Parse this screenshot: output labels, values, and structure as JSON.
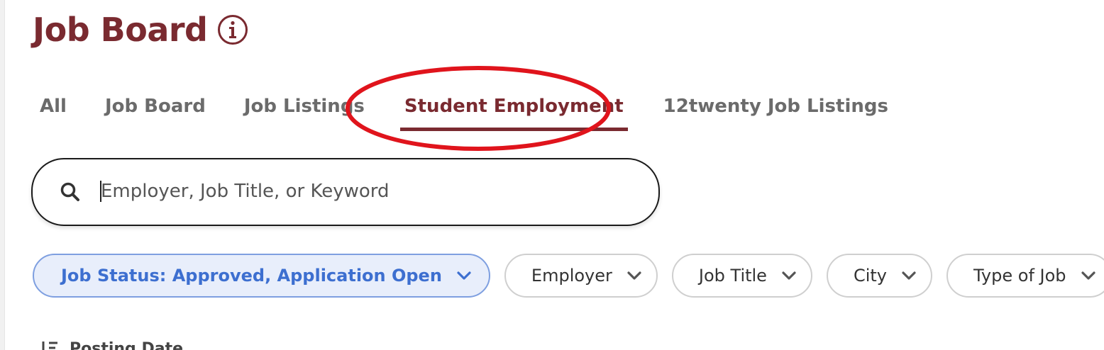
{
  "header": {
    "title": "Job Board",
    "info_icon": "info-circle-icon"
  },
  "tabs": [
    {
      "label": "All",
      "active": false
    },
    {
      "label": "Job Board",
      "active": false
    },
    {
      "label": "Job Listings",
      "active": false
    },
    {
      "label": "Student Employment",
      "active": true
    },
    {
      "label": "12twenty Job Listings",
      "active": false
    }
  ],
  "search": {
    "placeholder": "Employer, Job Title, or Keyword",
    "value": "",
    "icon": "search-icon"
  },
  "filters": [
    {
      "label": "Job Status: Approved, Application Open",
      "active": true
    },
    {
      "label": "Employer",
      "active": false
    },
    {
      "label": "Job Title",
      "active": false
    },
    {
      "label": "City",
      "active": false
    },
    {
      "label": "Type of Job",
      "active": false
    }
  ],
  "sort": {
    "label": "Posting Date",
    "icon": "sort-icon"
  },
  "colors": {
    "brand": "#7a2a30",
    "annotation": "#e0141c",
    "active_filter": "#3d6fd0",
    "active_filter_bg": "#e8eefb"
  }
}
